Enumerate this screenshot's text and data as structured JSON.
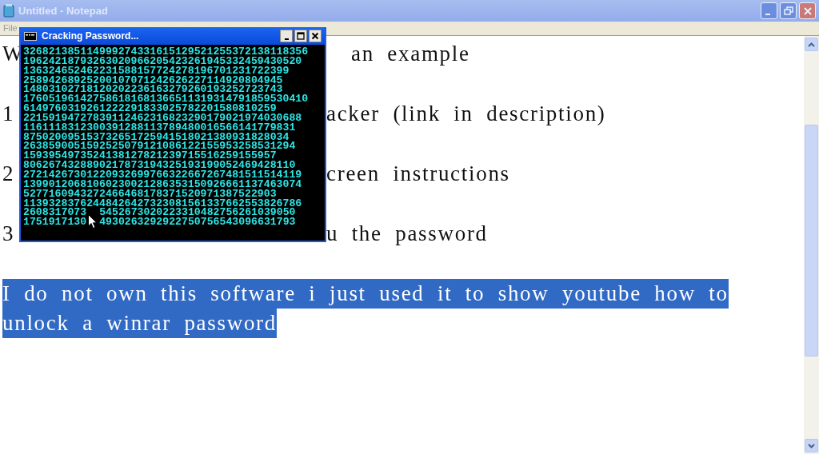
{
  "notepad": {
    "title": "Untitled - Notepad",
    "active": false,
    "menu": [
      "File"
    ],
    "lines": [
      {
        "start": "W",
        "end": "an example"
      },
      {
        "start": "1",
        "end": "acker  (link in description)"
      },
      {
        "start": "2",
        "end": "creen instructions"
      },
      {
        "start": "3",
        "end": "u the password"
      }
    ],
    "selected_lines": [
      "I do not own this software i just used it to show youtube how to",
      "unlock a winrar password"
    ]
  },
  "console": {
    "title": "Cracking Password...",
    "active": true,
    "lines": [
      {
        "text": "326821385114999274331615129521255372138118356"
      },
      {
        "text": "19624218793263020966205423261945332459430520"
      },
      {
        "text": "136324652462231588157724278196701231722399"
      },
      {
        "text": "25894268925200107071242626227114920804945"
      },
      {
        "text": "14803102718120202236163279260193252723743"
      },
      {
        "text": "176051961427586181681366511319314791859530410"
      },
      {
        "text": "6149760319261222291833025782201580810259"
      },
      {
        "text": "22159194727839112462316823290179021974030688"
      },
      {
        "text": "1161118312300391288113789480016566141779831"
      },
      {
        "text": "875020095153732651725941518021380931828034"
      },
      {
        "text": "2638590051592525079121086122155953258531294"
      },
      {
        "text": "1593954973524138127821239715516259155957"
      },
      {
        "text": "8062674328890217873194325193199052469428110"
      },
      {
        "text": "27214267301220932699766322667267481511514119"
      },
      {
        "text": "13990120681060230021286353150926661137463074"
      },
      {
        "text": "5277160943272466468178371520971387522903"
      },
      {
        "text": "11393283762448426427323081561337662553826786"
      },
      {
        "text": "2608317073",
        "text_after": "5452673020223310482756261039050"
      },
      {
        "text": "1751917130",
        "text_after": "4930263292922750756543096631793"
      }
    ]
  }
}
